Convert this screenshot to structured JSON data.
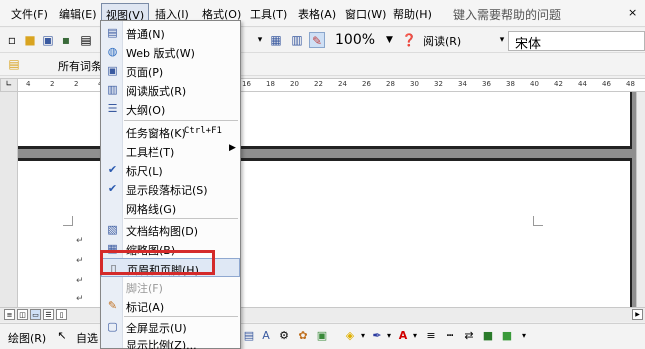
{
  "menubar": {
    "items": [
      {
        "label": "文件(F)"
      },
      {
        "label": "编辑(E)"
      },
      {
        "label": "视图(V)"
      },
      {
        "label": "插入(I)"
      },
      {
        "label": "格式(O)"
      },
      {
        "label": "工具(T)"
      },
      {
        "label": "表格(A)"
      },
      {
        "label": "窗口(W)"
      },
      {
        "label": "帮助(H)"
      }
    ],
    "help_placeholder": "键入需要帮助的问题",
    "close_glyph": "×"
  },
  "toolbar": {
    "zoom": "100%",
    "read_button": "阅读(R)",
    "font": "宋体"
  },
  "toolbar2": {
    "label": "所有词条"
  },
  "ruler": {
    "numbers": [
      "4",
      "2",
      "2",
      "4",
      "6",
      "8",
      "10",
      "12",
      "14",
      "16",
      "18",
      "20",
      "22",
      "24",
      "26",
      "28",
      "30",
      "32",
      "34",
      "36",
      "38",
      "40",
      "42",
      "44",
      "46",
      "48"
    ]
  },
  "view_menu": {
    "items": [
      {
        "label": "普通(N)",
        "icon": "normal-view-icon"
      },
      {
        "label": "Web 版式(W)",
        "icon": "web-layout-icon"
      },
      {
        "label": "页面(P)",
        "icon": "page-layout-icon"
      },
      {
        "label": "阅读版式(R)",
        "icon": "reading-layout-icon"
      },
      {
        "label": "大纲(O)",
        "icon": "outline-view-icon"
      },
      {
        "label": "任务窗格(K)",
        "shortcut": "Ctrl+F1"
      },
      {
        "label": "工具栏(T)",
        "submenu": true
      },
      {
        "label": "标尺(L)",
        "checked": true
      },
      {
        "label": "显示段落标记(S)",
        "checked": true
      },
      {
        "label": "网格线(G)"
      },
      {
        "label": "文档结构图(D)",
        "icon": "document-map-icon"
      },
      {
        "label": "缩略图(B)",
        "icon": "thumbnails-icon"
      },
      {
        "label": "页眉和页脚(H)",
        "icon": "header-footer-icon",
        "highlighted": true
      },
      {
        "label": "脚注(F)",
        "disabled": true
      },
      {
        "label": "标记(A)",
        "icon": "markup-icon"
      },
      {
        "label": "全屏显示(U)",
        "icon": "full-screen-icon"
      },
      {
        "label": "显示比例(Z)..."
      }
    ],
    "more_glyph": "⌄"
  },
  "drawbar": {
    "draw_label": "绘图(R)",
    "autoshape_label": "自选"
  },
  "colors": {
    "highlight_box": "#d42a2a",
    "menu_highlight": "#dfe8f5"
  }
}
